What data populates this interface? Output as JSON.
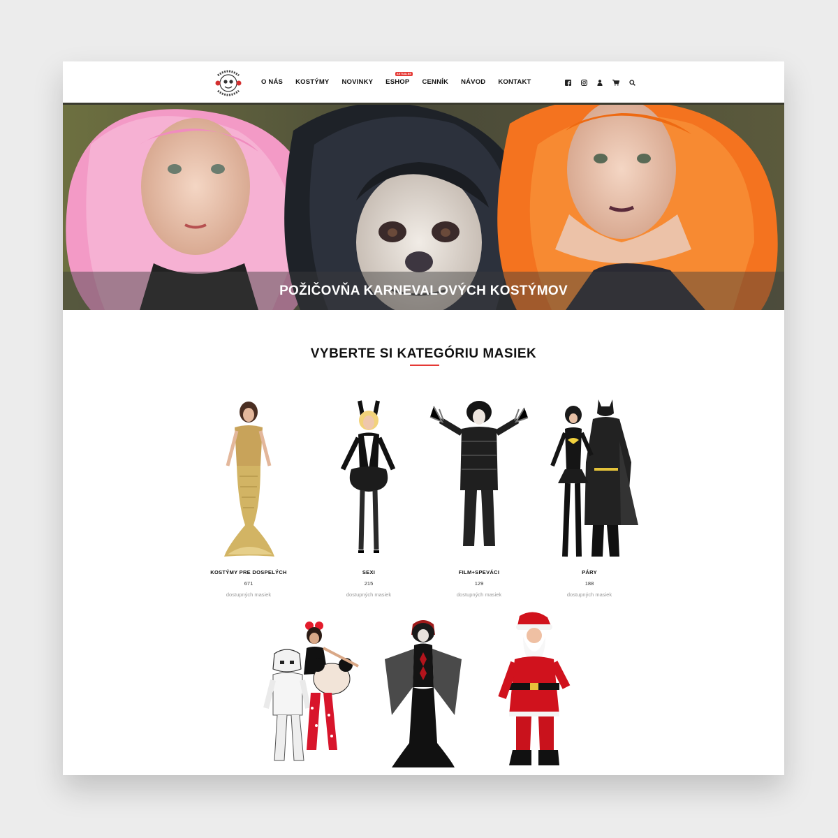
{
  "header": {
    "logo_text": "MASKY NA KARNEVAL",
    "nav": [
      {
        "label": "O NÁS"
      },
      {
        "label": "KOSTÝMY"
      },
      {
        "label": "NOVINKY"
      },
      {
        "label": "ESHOP",
        "badge": "AKTUALNE"
      },
      {
        "label": "CENNÍK"
      },
      {
        "label": "NÁVOD"
      },
      {
        "label": "KONTAKT"
      }
    ],
    "icons": [
      "facebook-icon",
      "instagram-icon",
      "user-icon",
      "cart-icon",
      "search-icon"
    ]
  },
  "hero": {
    "title": "POŽIČOVŇA KARNEVALOVÝCH KOSTÝMOV"
  },
  "section": {
    "title": "VYBERTE SI KATEGÓRIU MASIEK"
  },
  "categories": [
    {
      "name": "KOSTÝMY PRE DOSPELÝCH",
      "count": "671",
      "sub": "dostupných masiek"
    },
    {
      "name": "SEXI",
      "count": "215",
      "sub": "dostupných masiek"
    },
    {
      "name": "FILM+SPEVÁCI",
      "count": "129",
      "sub": "dostupných masiek"
    },
    {
      "name": "PÁRY",
      "count": "188",
      "sub": "dostupných masiek"
    }
  ],
  "colors": {
    "accent": "#e53935",
    "text": "#111111",
    "muted": "#999999"
  }
}
